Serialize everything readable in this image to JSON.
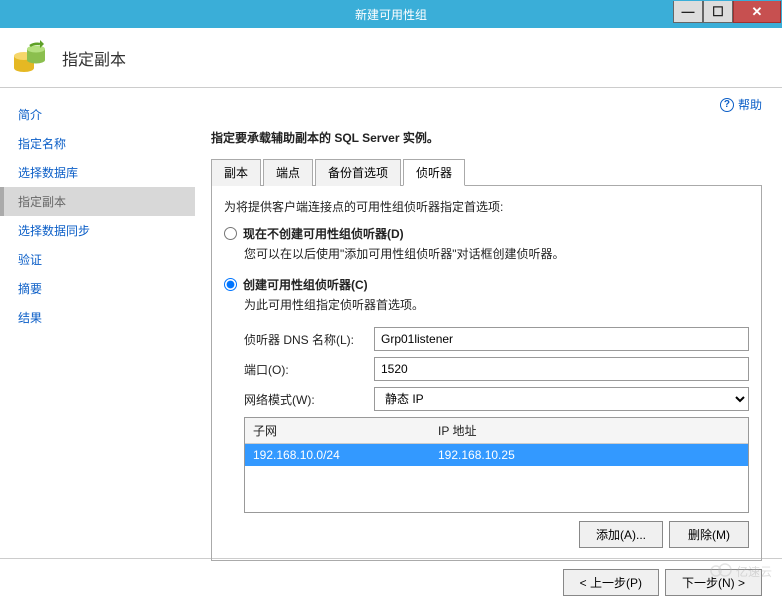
{
  "window": {
    "title": "新建可用性组"
  },
  "header": {
    "title": "指定副本"
  },
  "sidebar": {
    "items": [
      {
        "label": "简介"
      },
      {
        "label": "指定名称"
      },
      {
        "label": "选择数据库"
      },
      {
        "label": "指定副本"
      },
      {
        "label": "选择数据同步"
      },
      {
        "label": "验证"
      },
      {
        "label": "摘要"
      },
      {
        "label": "结果"
      }
    ]
  },
  "help": {
    "label": "帮助"
  },
  "instruction": "指定要承载辅助副本的 SQL Server 实例。",
  "tabs": {
    "items": [
      {
        "label": "副本"
      },
      {
        "label": "端点"
      },
      {
        "label": "备份首选项"
      },
      {
        "label": "侦听器"
      }
    ]
  },
  "listener": {
    "desc": "为将提供客户端连接点的可用性组侦听器指定首选项:",
    "radio1": {
      "label": "现在不创建可用性组侦听器(D)",
      "desc": "您可以在以后使用\"添加可用性组侦听器\"对话框创建侦听器。"
    },
    "radio2": {
      "label": "创建可用性组侦听器(C)",
      "desc": "为此可用性组指定侦听器首选项。"
    },
    "form": {
      "dns_label": "侦听器 DNS 名称(L):",
      "dns_value": "Grp01listener",
      "port_label": "端口(O):",
      "port_value": "1520",
      "netmode_label": "网络模式(W):",
      "netmode_value": "静态 IP"
    },
    "grid": {
      "col_subnet": "子网",
      "col_ip": "IP 地址",
      "rows": [
        {
          "subnet": "192.168.10.0/24",
          "ip": "192.168.10.25"
        }
      ]
    },
    "buttons": {
      "add": "添加(A)...",
      "remove": "删除(M)"
    }
  },
  "footer": {
    "prev": "< 上一步(P)",
    "next": "下一步(N) >"
  },
  "watermark": "亿速云"
}
